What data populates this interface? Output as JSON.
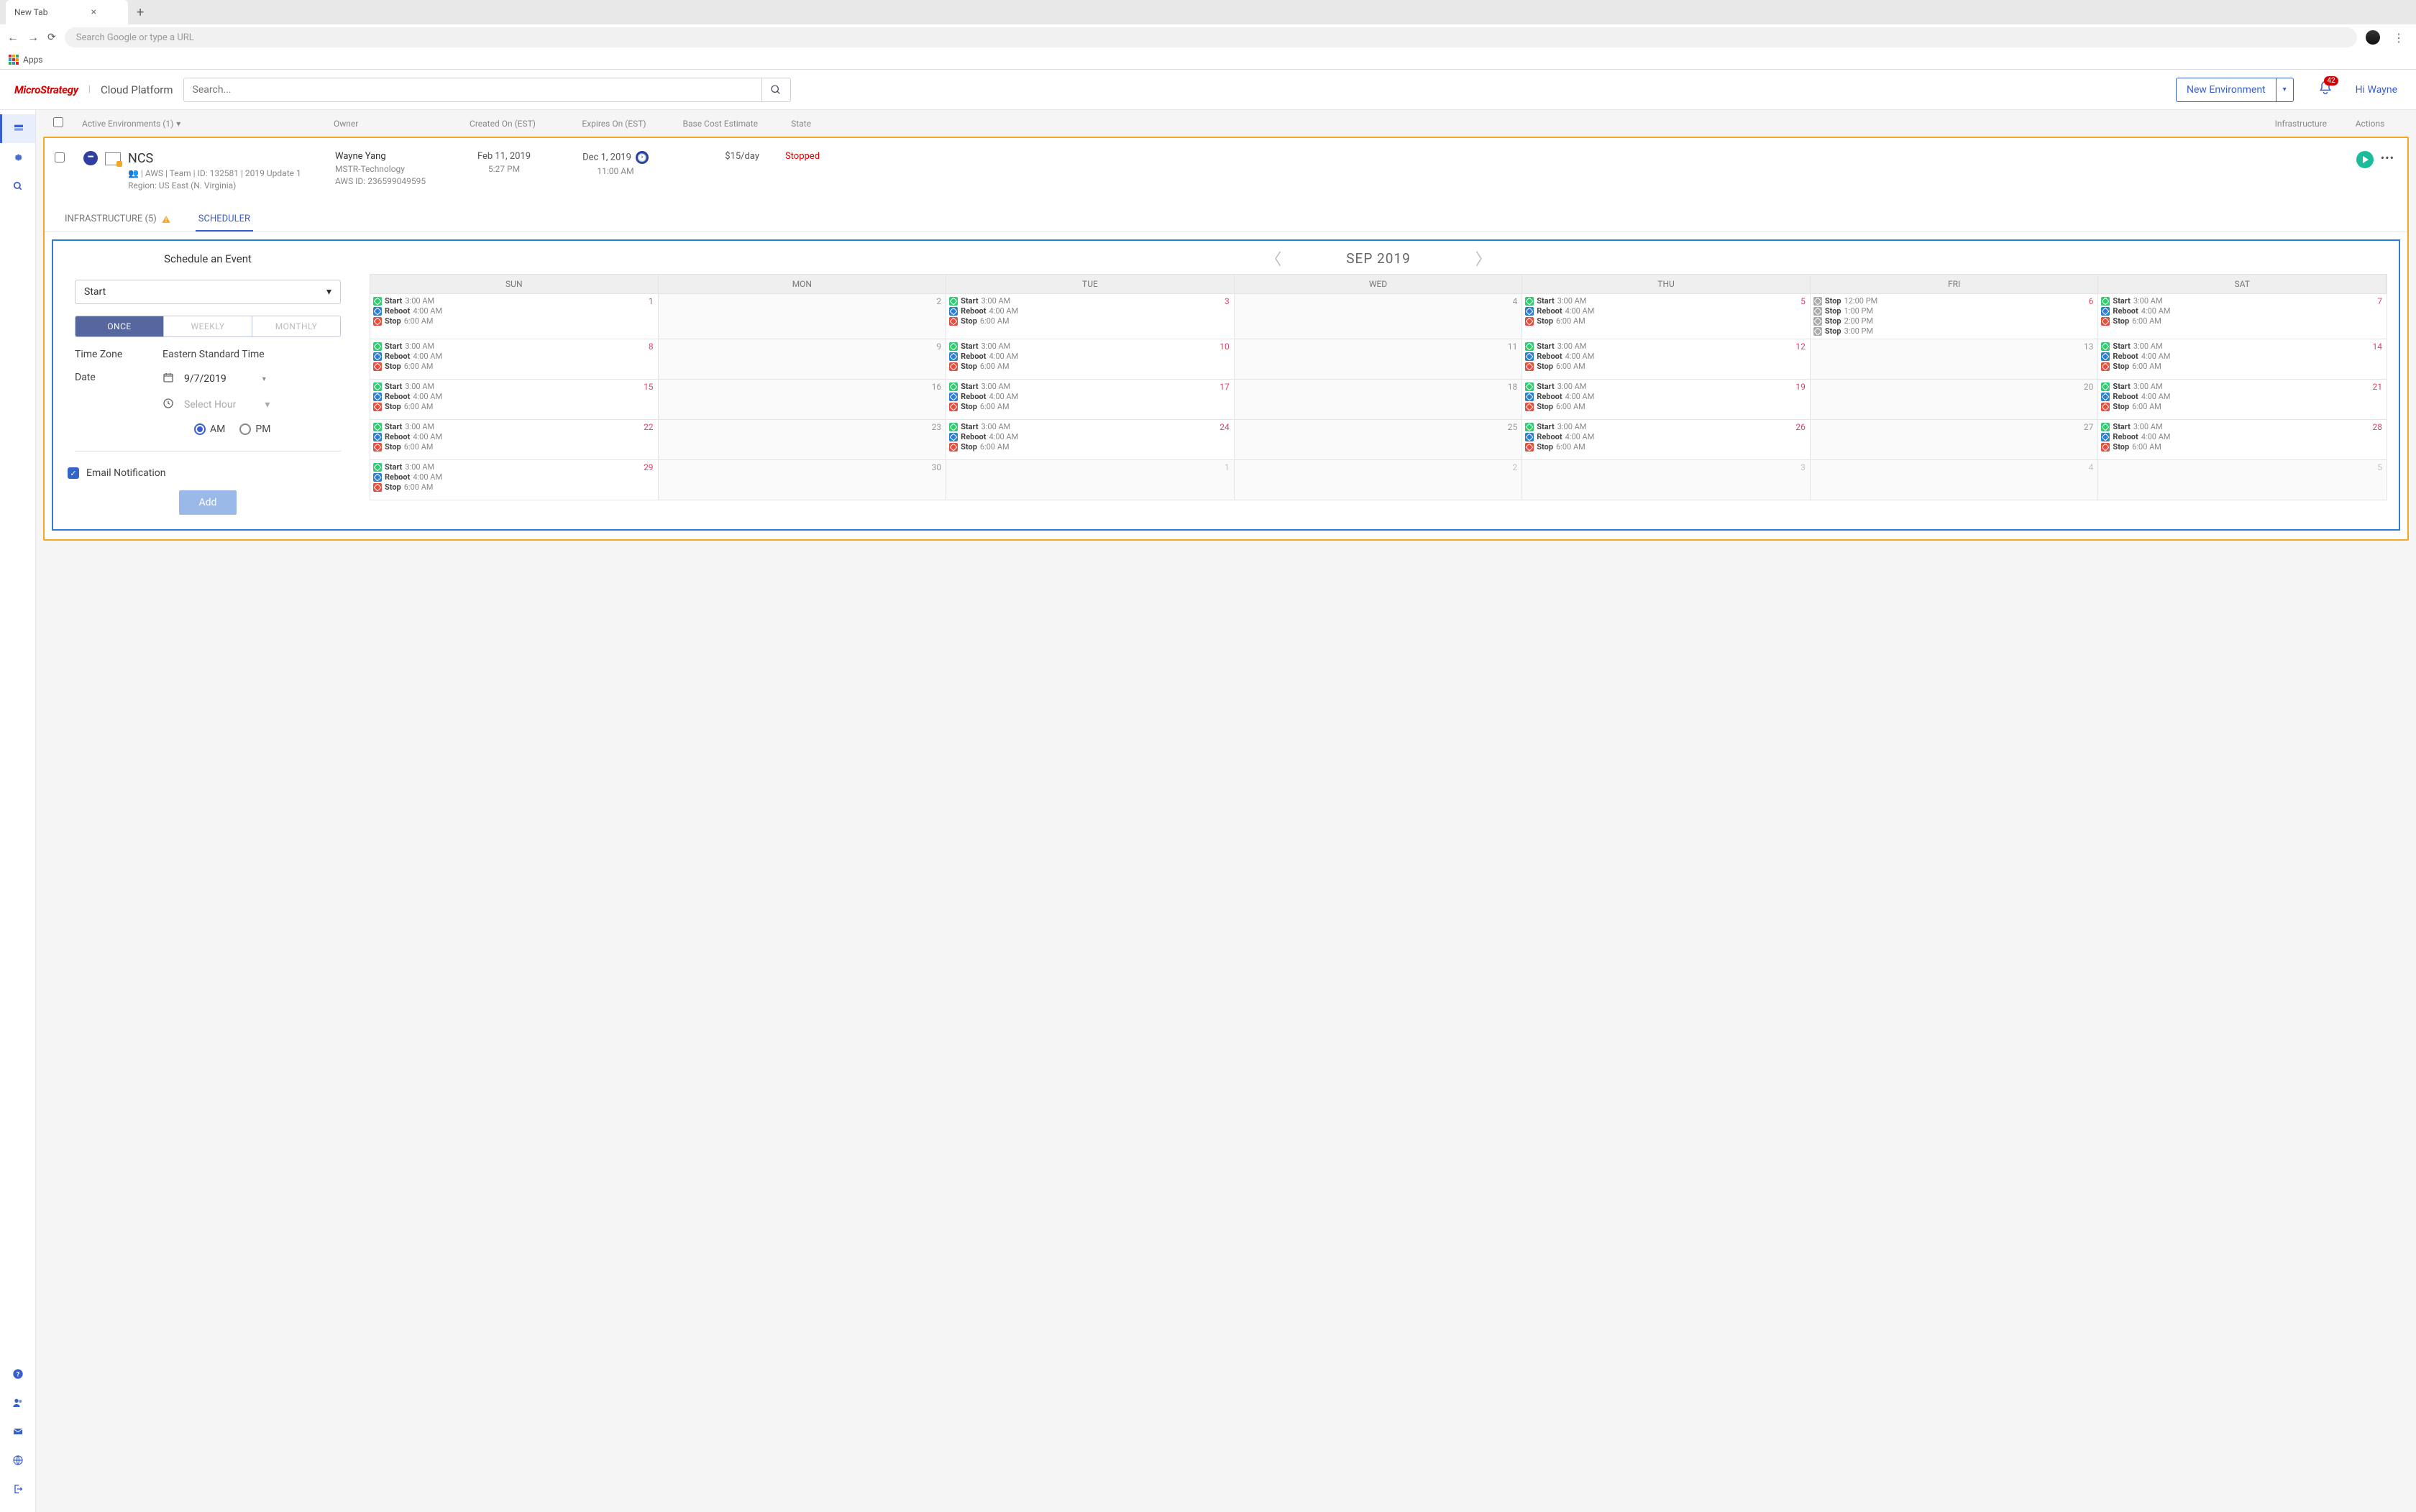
{
  "browser": {
    "tab_title": "New Tab",
    "omnibox_placeholder": "Search Google or type a URL",
    "apps_label": "Apps"
  },
  "header": {
    "brand": "MicroStrategy",
    "product": "Cloud Platform",
    "search_placeholder": "Search...",
    "new_env_label": "New Environment",
    "greeting": "Hi Wayne",
    "notif_count": "42"
  },
  "table": {
    "columns": {
      "name": "Active Environments (1)",
      "owner": "Owner",
      "created": "Created On (EST)",
      "expires": "Expires On (EST)",
      "cost": "Base Cost Estimate",
      "state": "State",
      "infrastructure": "Infrastructure",
      "actions": "Actions"
    }
  },
  "env": {
    "name": "NCS",
    "meta1_prefix": " | AWS | Team | ID: 132581 | 2019 Update 1",
    "meta2": "Region: US East (N. Virginia)",
    "owner_name": "Wayne Yang",
    "owner_org": "MSTR-Technology",
    "owner_aws": "AWS ID: 236599049595",
    "created_date": "Feb 11, 2019",
    "created_time": "5:27 PM",
    "expires_date": "Dec 1, 2019",
    "expires_time": "11:00 AM",
    "cost": "$15/day",
    "state": "Stopped"
  },
  "tabs": {
    "infrastructure": "INFRASTRUCTURE (5)",
    "scheduler": "SCHEDULER"
  },
  "form": {
    "title": "Schedule an Event",
    "type_value": "Start",
    "freq": {
      "once": "ONCE",
      "weekly": "WEEKLY",
      "monthly": "MONTHLY"
    },
    "tz_label": "Time Zone",
    "tz_value": "Eastern Standard Time",
    "date_label": "Date",
    "date_value": "9/7/2019",
    "hour_placeholder": "Select Hour",
    "am": "AM",
    "pm": "PM",
    "notify_label": "Email Notification",
    "add_label": "Add"
  },
  "calendar": {
    "month": "SEP 2019",
    "dow": [
      "SUN",
      "MON",
      "TUE",
      "WED",
      "THU",
      "FRI",
      "SAT"
    ],
    "event_labels": {
      "start": "Start",
      "reboot": "Reboot",
      "stop": "Stop"
    },
    "day_times": {
      "start": "3:00 AM",
      "reboot": "4:00 AM",
      "stop": "6:00 AM"
    },
    "fri6": [
      {
        "label": "Stop",
        "time": "12:00 PM"
      },
      {
        "label": "Stop",
        "time": "1:00 PM"
      },
      {
        "label": "Stop",
        "time": "2:00 PM"
      },
      {
        "label": "Stop",
        "time": "3:00 PM"
      }
    ],
    "weeks": [
      [
        {
          "n": "1",
          "events": true
        },
        {
          "n": "2",
          "events": false
        },
        {
          "n": "3",
          "events": true
        },
        {
          "n": "4",
          "events": false
        },
        {
          "n": "5",
          "events": true
        },
        {
          "n": "6",
          "events": "fri6"
        },
        {
          "n": "7",
          "events": true
        }
      ],
      [
        {
          "n": "8",
          "events": true
        },
        {
          "n": "9",
          "events": false
        },
        {
          "n": "10",
          "events": true
        },
        {
          "n": "11",
          "events": false
        },
        {
          "n": "12",
          "events": true
        },
        {
          "n": "13",
          "events": false
        },
        {
          "n": "14",
          "events": true
        }
      ],
      [
        {
          "n": "15",
          "events": true
        },
        {
          "n": "16",
          "events": false
        },
        {
          "n": "17",
          "events": true
        },
        {
          "n": "18",
          "events": false
        },
        {
          "n": "19",
          "events": true
        },
        {
          "n": "20",
          "events": false
        },
        {
          "n": "21",
          "events": true
        }
      ],
      [
        {
          "n": "22",
          "events": true
        },
        {
          "n": "23",
          "events": false
        },
        {
          "n": "24",
          "events": true
        },
        {
          "n": "25",
          "events": false
        },
        {
          "n": "26",
          "events": true
        },
        {
          "n": "27",
          "events": false
        },
        {
          "n": "28",
          "events": true
        }
      ],
      [
        {
          "n": "29",
          "events": true
        },
        {
          "n": "30",
          "events": false
        },
        {
          "n": "1",
          "events": false,
          "other": true
        },
        {
          "n": "2",
          "events": false,
          "other": true
        },
        {
          "n": "3",
          "events": false,
          "other": true
        },
        {
          "n": "4",
          "events": false,
          "other": true
        },
        {
          "n": "5",
          "events": false,
          "other": true
        }
      ]
    ]
  }
}
